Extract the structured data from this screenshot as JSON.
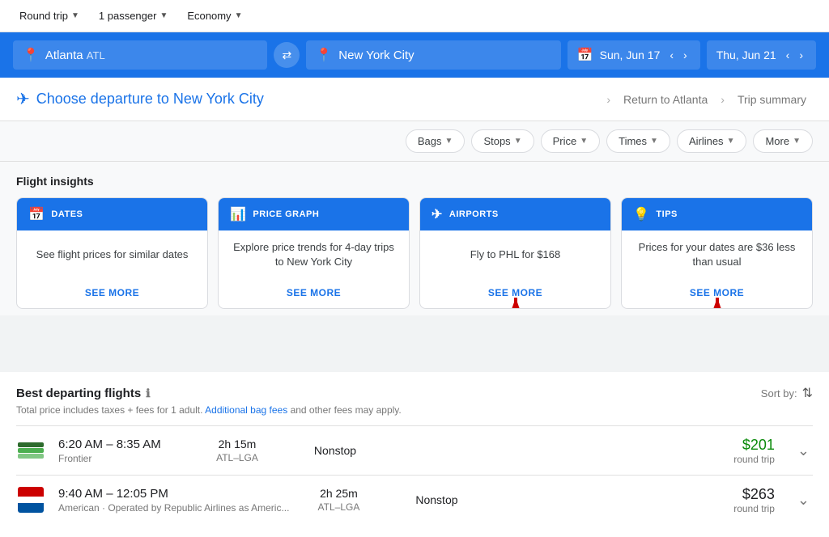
{
  "topbar": {
    "trip_type": "Round trip",
    "passengers": "1 passenger",
    "cabin": "Economy"
  },
  "searchbar": {
    "origin": "Atlanta",
    "origin_code": "ATL",
    "destination": "New York City",
    "depart_date": "Sun, Jun 17",
    "return_date": "Thu, Jun 21",
    "swap_label": "⇄"
  },
  "choosebar": {
    "heading": "Choose departure to New York City",
    "step2": "Return to Atlanta",
    "step3": "Trip summary"
  },
  "filters": {
    "bags": "Bags",
    "stops": "Stops",
    "price": "Price",
    "times": "Times",
    "airlines": "Airlines",
    "more": "More"
  },
  "insights": {
    "title": "Flight insights",
    "cards": [
      {
        "icon": "📅",
        "label": "DATES",
        "body": "See flight prices for similar dates",
        "action": "SEE MORE"
      },
      {
        "icon": "📊",
        "label": "PRICE GRAPH",
        "body": "Explore price trends for 4-day trips to New York City",
        "action": "SEE MORE"
      },
      {
        "icon": "✈",
        "label": "AIRPORTS",
        "body": "Fly to PHL for $168",
        "action": "SEE MORE"
      },
      {
        "icon": "💡",
        "label": "TIPS",
        "body": "Prices for your dates are $36 less than usual",
        "action": "SEE MORE"
      }
    ]
  },
  "flights": {
    "title": "Best departing flights",
    "subtitle": "Total price includes taxes + fees for 1 adult.",
    "bag_fees_link": "Additional bag fees",
    "subtitle2": " and other fees may apply.",
    "sort_by": "Sort by:",
    "rows": [
      {
        "airline": "Frontier",
        "time_range": "6:20 AM – 8:35 AM",
        "duration": "2h 15m",
        "route": "ATL–LGA",
        "stops": "Nonstop",
        "price": "$201",
        "price_color": "green",
        "price_label": "round trip",
        "logo_type": "frontier"
      },
      {
        "airline": "American · Operated by Republic Airlines as Americ...",
        "time_range": "9:40 AM – 12:05 PM",
        "duration": "2h 25m",
        "route": "ATL–LGA",
        "stops": "Nonstop",
        "price": "$263",
        "price_color": "black",
        "price_label": "round trip",
        "logo_type": "american"
      }
    ]
  }
}
